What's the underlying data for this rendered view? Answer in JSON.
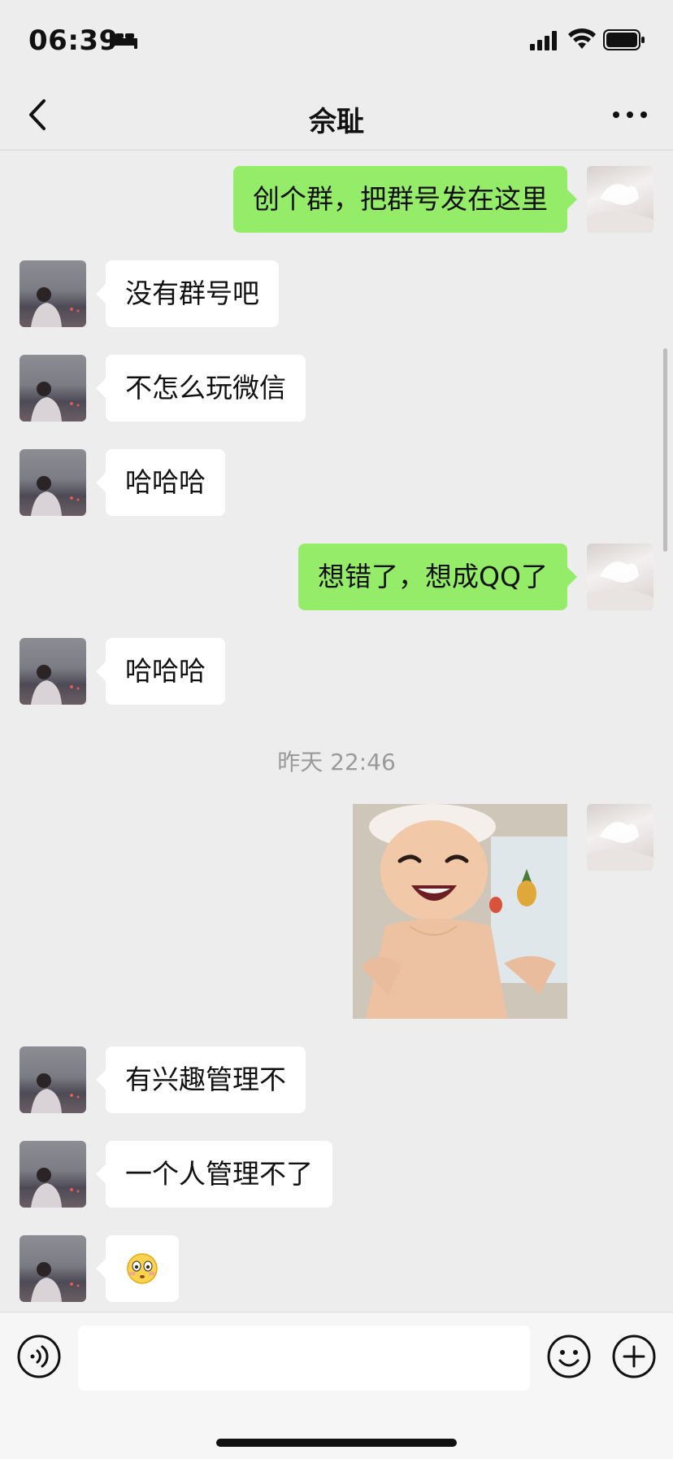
{
  "status_bar": {
    "time": "06:39"
  },
  "chat": {
    "title": "佘耻"
  },
  "messages": [
    {
      "side": "me",
      "text": "创个群，把群号发在这里"
    },
    {
      "side": "them",
      "text": "没有群号吧"
    },
    {
      "side": "them",
      "text": "不怎么玩微信"
    },
    {
      "side": "them",
      "text": "哈哈哈"
    },
    {
      "side": "me",
      "text": "想错了，想成QQ了"
    },
    {
      "side": "them",
      "text": "哈哈哈"
    },
    {
      "type": "timestamp",
      "text": "昨天 22:46"
    },
    {
      "side": "me",
      "type": "sticker",
      "icon": "laughing-baby-sticker"
    },
    {
      "side": "them",
      "text": "有兴趣管理不"
    },
    {
      "side": "them",
      "text": "一个人管理不了"
    },
    {
      "side": "them",
      "type": "emoji",
      "icon": "flushed-face-emoji"
    }
  ],
  "colors": {
    "me_bubble": "#95ec69",
    "them_bubble": "#ffffff",
    "background": "#ededed"
  },
  "input": {
    "value": ""
  }
}
